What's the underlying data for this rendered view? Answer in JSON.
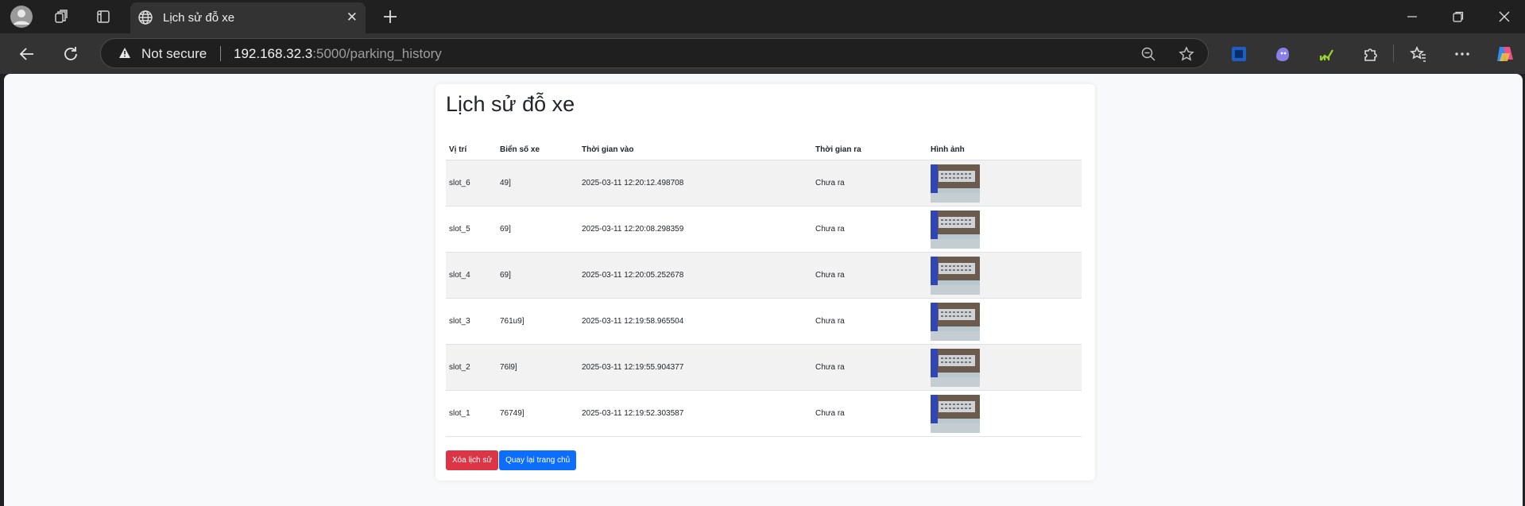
{
  "browser": {
    "tab": {
      "title": "Lịch sử đỗ xe"
    },
    "address": {
      "security_label": "Not secure",
      "url_host": "192.168.32.3",
      "url_path": ":5000/parking_history"
    },
    "icons": {
      "profile": "avatar-icon",
      "workspaces": "workspaces-icon",
      "tab_actions": "tab-actions-icon",
      "new_tab": "plus-icon",
      "minimize": "minimize-icon",
      "restore": "restore-icon",
      "close": "close-icon",
      "back": "back-arrow-icon",
      "refresh": "refresh-icon",
      "zoom": "zoom-out-icon",
      "favorite": "star-icon",
      "extensions": "puzzle-icon",
      "favorites_bar": "favorites-icon",
      "more": "more-icon",
      "copilot": "copilot-icon"
    },
    "colors": {
      "accent_danger": "#dc3545",
      "accent_primary": "#0d6efd"
    }
  },
  "page": {
    "title": "Lịch sử đỗ xe",
    "table": {
      "headers": {
        "position": "Vị trí",
        "plate": "Biển số xe",
        "time_in": "Thời gian vào",
        "time_out": "Thời gian ra",
        "image": "Hình ảnh"
      },
      "rows": [
        {
          "slot": "slot_6",
          "plate": "49]",
          "time_in": "2025-03-11 12:20:12.498708",
          "time_out": "Chưa ra"
        },
        {
          "slot": "slot_5",
          "plate": "69]",
          "time_in": "2025-03-11 12:20:08.298359",
          "time_out": "Chưa ra"
        },
        {
          "slot": "slot_4",
          "plate": "69]",
          "time_in": "2025-03-11 12:20:05.252678",
          "time_out": "Chưa ra"
        },
        {
          "slot": "slot_3",
          "plate": "761u9]",
          "time_in": "2025-03-11 12:19:58.965504",
          "time_out": "Chưa ra"
        },
        {
          "slot": "slot_2",
          "plate": "76l9]",
          "time_in": "2025-03-11 12:19:55.904377",
          "time_out": "Chưa ra"
        },
        {
          "slot": "slot_1",
          "plate": "76749]",
          "time_in": "2025-03-11 12:19:52.303587",
          "time_out": "Chưa ra"
        }
      ]
    },
    "buttons": {
      "clear": "Xóa lịch sử",
      "home": "Quay lại trang chủ"
    }
  }
}
